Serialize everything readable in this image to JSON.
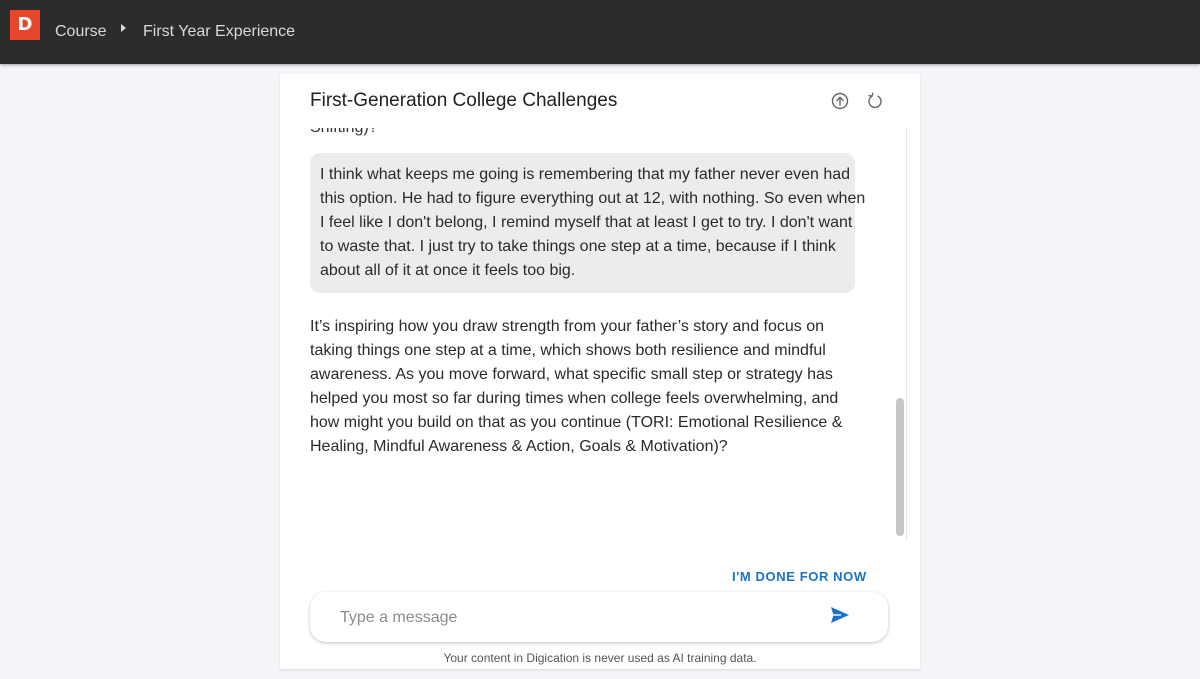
{
  "header": {
    "logo_letter": "D",
    "breadcrumb": [
      "Course",
      "First Year Experience"
    ]
  },
  "card": {
    "title": "First-Generation College Challenges",
    "icons": [
      "upload-icon",
      "refresh-icon"
    ]
  },
  "conversation": {
    "clipped_text": "Shifting)?",
    "user_message": "I think what keeps me going is remembering that my father never even had this option. He had to figure everything out at 12, with nothing. So even when I feel like I don't belong, I remind myself that at least I get to try. I don't want to waste that. I just try to take things one step at a time, because if I think about all of it at once it feels too big.",
    "assistant_message": "It’s inspiring how you draw strength from your father’s story and focus on taking things one step at a time, which shows both resilience and mindful awareness. As you move forward, what specific small step or strategy has helped you most so far during times when college feels overwhelming, and how might you build on that as you continue (TORI: Emotional Resilience & Healing, Mindful Awareness & Action, Goals & Motivation)?"
  },
  "actions": {
    "done_label": "I'M DONE FOR NOW"
  },
  "composer": {
    "placeholder": "Type a message",
    "value": ""
  },
  "footer": {
    "note": "Your content in Digication is never used as AI training data."
  },
  "colors": {
    "topbar": "#2b2c2e",
    "logo": "#e8452a",
    "accent": "#1a73c8"
  }
}
